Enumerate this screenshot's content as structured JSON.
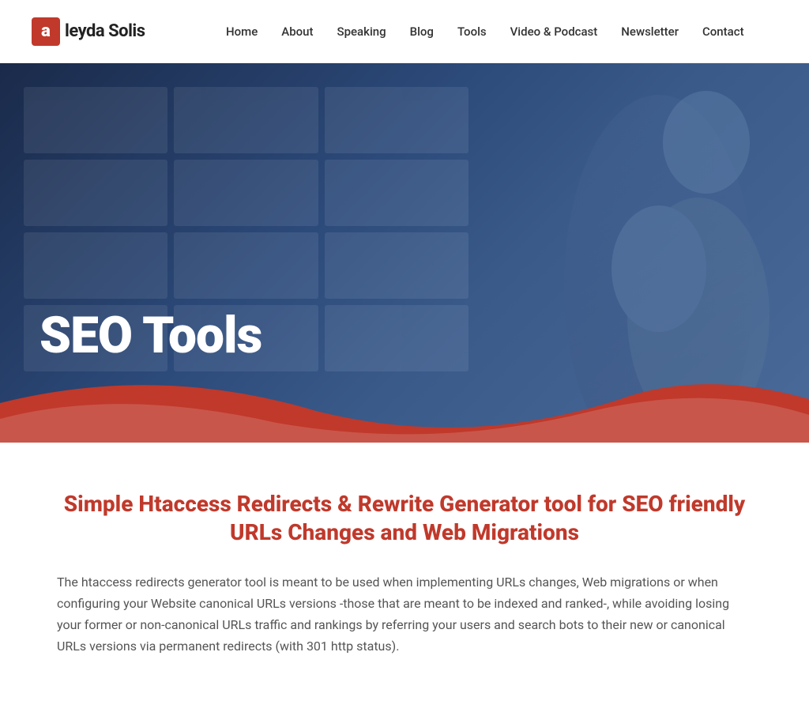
{
  "header": {
    "logo": {
      "letter": "a",
      "name": "leyda Solis"
    },
    "nav": {
      "items": [
        {
          "label": "Home",
          "href": "#"
        },
        {
          "label": "About",
          "href": "#"
        },
        {
          "label": "Speaking",
          "href": "#"
        },
        {
          "label": "Blog",
          "href": "#"
        },
        {
          "label": "Tools",
          "href": "#"
        },
        {
          "label": "Video & Podcast",
          "href": "#"
        },
        {
          "label": "Newsletter",
          "href": "#"
        },
        {
          "label": "Contact",
          "href": "#"
        }
      ]
    }
  },
  "hero": {
    "title": "SEO Tools"
  },
  "main": {
    "heading": "Simple Htaccess Redirects & Rewrite Generator tool for SEO friendly URLs Changes and Web Migrations",
    "body_paragraphs": [
      "The htaccess redirects generator tool is meant to be used when implementing URLs changes, Web migrations or when configuring your Website canonical URLs versions -those that are meant to be indexed and ranked-, while avoiding losing your former or non-canonical URLs traffic and rankings by referring your users and search bots to their new or canonical URLs versions via permanent redirects (with 301 http status)."
    ]
  },
  "colors": {
    "brand_red": "#c0392b",
    "hero_dark": "#1a2a4a",
    "hero_mid": "#2c4a7a",
    "text_dark": "#222",
    "text_body": "#555"
  }
}
